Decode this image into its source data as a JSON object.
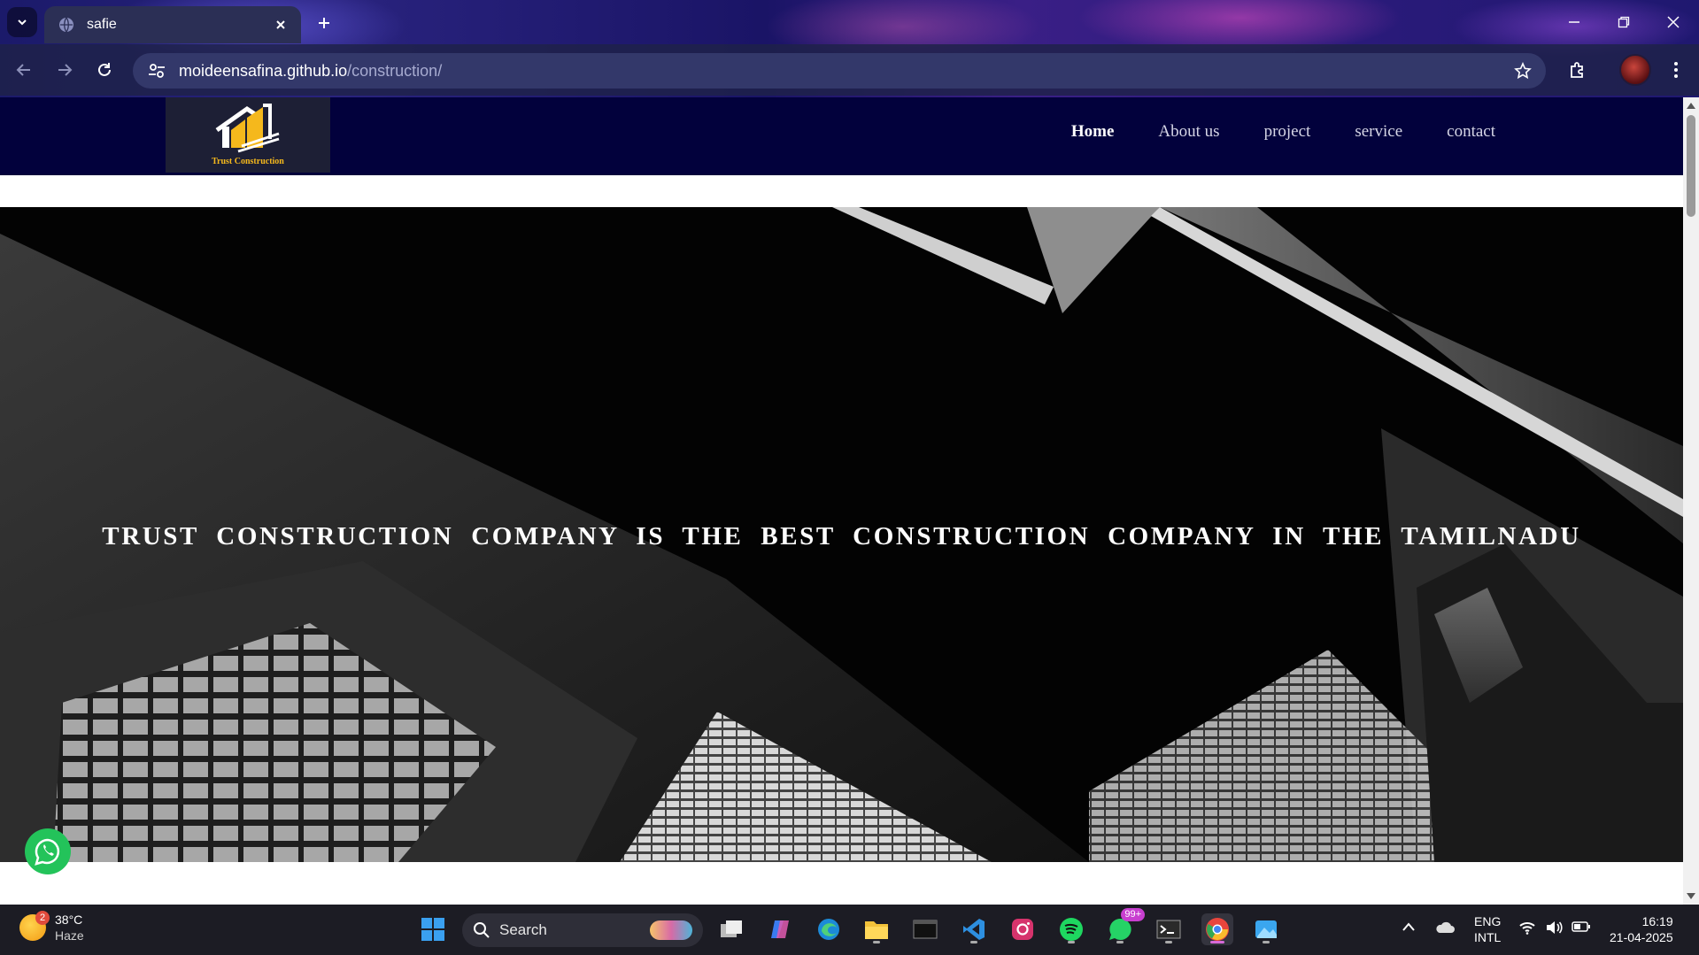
{
  "browser": {
    "tab_title": "safie",
    "url_host": "moideensafina.github.io",
    "url_path": "/construction/"
  },
  "site": {
    "logo_caption": "Trust Construction",
    "menu": [
      {
        "label": "Home",
        "active": true
      },
      {
        "label": "About us"
      },
      {
        "label": "project"
      },
      {
        "label": "service"
      },
      {
        "label": "contact"
      }
    ],
    "hero_text": "TRUST CONSTRUCTION COMPANY IS THE BEST CONSTRUCTION COMPANY IN THE TAMILNADU"
  },
  "taskbar": {
    "weather_temp": "38°C",
    "weather_desc": "Haze",
    "weather_badge": "2",
    "search_placeholder": "Search",
    "whatsapp_badge": "99+",
    "lang_line1": "ENG",
    "lang_line2": "INTL",
    "time": "16:19",
    "date": "21-04-2025"
  },
  "colors": {
    "site_nav_bg": "#02013c",
    "logo_accent": "#f5b81c",
    "whatsapp_green": "#23c35a"
  }
}
